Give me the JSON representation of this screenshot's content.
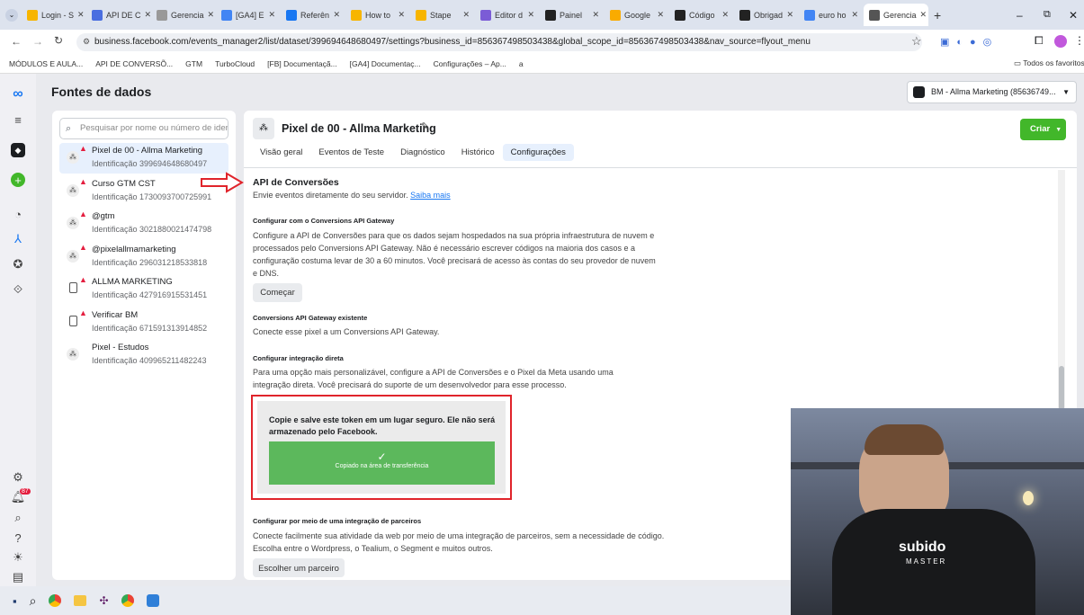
{
  "browser": {
    "tabs": [
      {
        "label": "Login - S",
        "color": "#f7b500"
      },
      {
        "label": "API DE C",
        "color": "#4a6ee0"
      },
      {
        "label": "Gerencia",
        "color": "#999999"
      },
      {
        "label": "[GA4] E",
        "color": "#4285f4"
      },
      {
        "label": "Referên",
        "color": "#1877f2"
      },
      {
        "label": "How to",
        "color": "#f7b500"
      },
      {
        "label": "Stape",
        "color": "#f7b500"
      },
      {
        "label": "Editor d",
        "color": "#7b5cd6"
      },
      {
        "label": "Painel",
        "color": "#222222"
      },
      {
        "label": "Google",
        "color": "#f9ab00"
      },
      {
        "label": "Código",
        "color": "#222222"
      },
      {
        "label": "Obrigad",
        "color": "#222222"
      },
      {
        "label": "euro ho",
        "color": "#4285f4"
      },
      {
        "label": "Gerencia",
        "color": "#555555"
      }
    ],
    "url": "business.facebook.com/events_manager2/list/dataset/399694648680497/settings?business_id=856367498503438&global_scope_id=856367498503438&nav_source=flyout_menu",
    "bookmarks": [
      "MÓDULOS E AULA...",
      "API DE CONVERSÕ...",
      "GTM",
      "TurboCloud",
      "[FB] Documentaçã...",
      "[GA4] Documentaç...",
      "Configurações – Ap...",
      "a"
    ],
    "all_favorites": "Todos os favoritos"
  },
  "header": {
    "title": "Fontes de dados",
    "business_selector": "BM - Allma Marketing (85636749..."
  },
  "sidebar": {
    "search_placeholder": "Pesquisar por nome ou número de ider",
    "notification_count": "87",
    "items": [
      {
        "name": "Pixel de 00 - Allma Marketing",
        "id": "Identificação 399694648680497",
        "warn": true,
        "kind": "pixel"
      },
      {
        "name": "Curso GTM CST",
        "id": "Identificação 1730093700725991",
        "warn": true,
        "kind": "pixel"
      },
      {
        "name": "@gtm",
        "id": "Identificação 3021880021474798",
        "warn": true,
        "kind": "pixel"
      },
      {
        "name": "@pixelallmamarketing",
        "id": "Identificação 296031218533818",
        "warn": true,
        "kind": "pixel"
      },
      {
        "name": "ALLMA MARKETING",
        "id": "Identificação 427916915531451",
        "warn": true,
        "kind": "app"
      },
      {
        "name": "Verificar BM",
        "id": "Identificação 671591313914852",
        "warn": true,
        "kind": "app"
      },
      {
        "name": "Pixel - Estudos",
        "id": "Identificação 409965211482243",
        "warn": false,
        "kind": "pixel"
      }
    ]
  },
  "main": {
    "title": "Pixel de 00 - Allma Marketing",
    "create_button": "Criar",
    "tabs": [
      "Visão geral",
      "Eventos de Teste",
      "Diagnóstico",
      "Histórico",
      "Configurações"
    ],
    "active_tab": "Configurações",
    "capi_title": "API de Conversões",
    "capi_desc": "Envie eventos diretamente do seu servidor.",
    "capi_link": "Saiba mais",
    "gateway_title": "Configurar com o Conversions API Gateway",
    "gateway_text": "Configure a API de Conversões para que os dados sejam hospedados na sua própria infraestrutura de nuvem e processados pelo Conversions API Gateway. Não é necessário escrever códigos na maioria dos casos e a configuração costuma levar de 30 a 60 minutos. Você precisará de acesso às contas do seu provedor de nuvem e DNS.",
    "start_button": "Começar",
    "existing_title": "Conversions API Gateway existente",
    "existing_text": "Conecte esse pixel a um Conversions API Gateway.",
    "direct_title": "Configurar integração direta",
    "direct_text": "Para uma opção mais personalizável, configure a API de Conversões e o Pixel da Meta usando uma integração direta. Você precisará do suporte de um desenvolvedor para esse processo.",
    "token_notice": "Copie e salve este token em um lugar seguro. Ele não será armazenado pelo Facebook.",
    "copied_text": "Copiado na área de transferência",
    "partner_title": "Configurar por meio de uma integração de parceiros",
    "partner_text": "Conecte facilmente sua atividade da web por meio de uma integração de parceiros, sem a necessidade de código. Escolha entre o Wordpress, o Tealium, o Segment e muitos outros.",
    "partner_button": "Escolher um parceiro"
  },
  "video": {
    "shirt_text": "subido",
    "shirt_sub": "MASTER"
  },
  "colors": {
    "accent": "#42b72a",
    "highlight": "#e0242b",
    "link": "#1877f2"
  }
}
